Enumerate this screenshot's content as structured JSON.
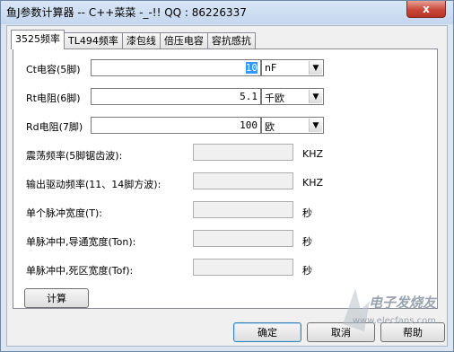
{
  "window": {
    "title": "鱼J参数计算器 -- C++菜菜 -_-!! QQ : 86226337",
    "close_label": "x"
  },
  "tabs": [
    {
      "label": "3525频率",
      "active": true
    },
    {
      "label": "TL494频率",
      "active": false
    },
    {
      "label": "漆包线",
      "active": false
    },
    {
      "label": "倍压电容",
      "active": false
    },
    {
      "label": "容抗感抗",
      "active": false
    }
  ],
  "form": {
    "ct": {
      "label": "Ct电容(5脚)",
      "value": "10",
      "unit": "nF"
    },
    "rt": {
      "label": "Rt电阻(6脚)",
      "value": "5.1",
      "unit": "千欧"
    },
    "rd": {
      "label": "Rd电阻(7脚)",
      "value": "100",
      "unit": "欧"
    }
  },
  "outputs": [
    {
      "label": "震荡频率(5脚锯齿波):",
      "value": "",
      "unit": "KHZ"
    },
    {
      "label": "输出驱动频率(11、14脚方波):",
      "value": "",
      "unit": "KHZ"
    },
    {
      "label": "单个脉冲宽度(T):",
      "value": "",
      "unit": "秒"
    },
    {
      "label": "单脉冲中,导通宽度(Ton):",
      "value": "",
      "unit": "秒"
    },
    {
      "label": "单脉冲中,死区宽度(Tof):",
      "value": "",
      "unit": "秒"
    }
  ],
  "buttons": {
    "calc": "计算",
    "ok": "确定",
    "cancel": "取消",
    "help": "帮助"
  },
  "watermark": {
    "text": "电子发烧友",
    "url": "www.elecfans.com"
  }
}
